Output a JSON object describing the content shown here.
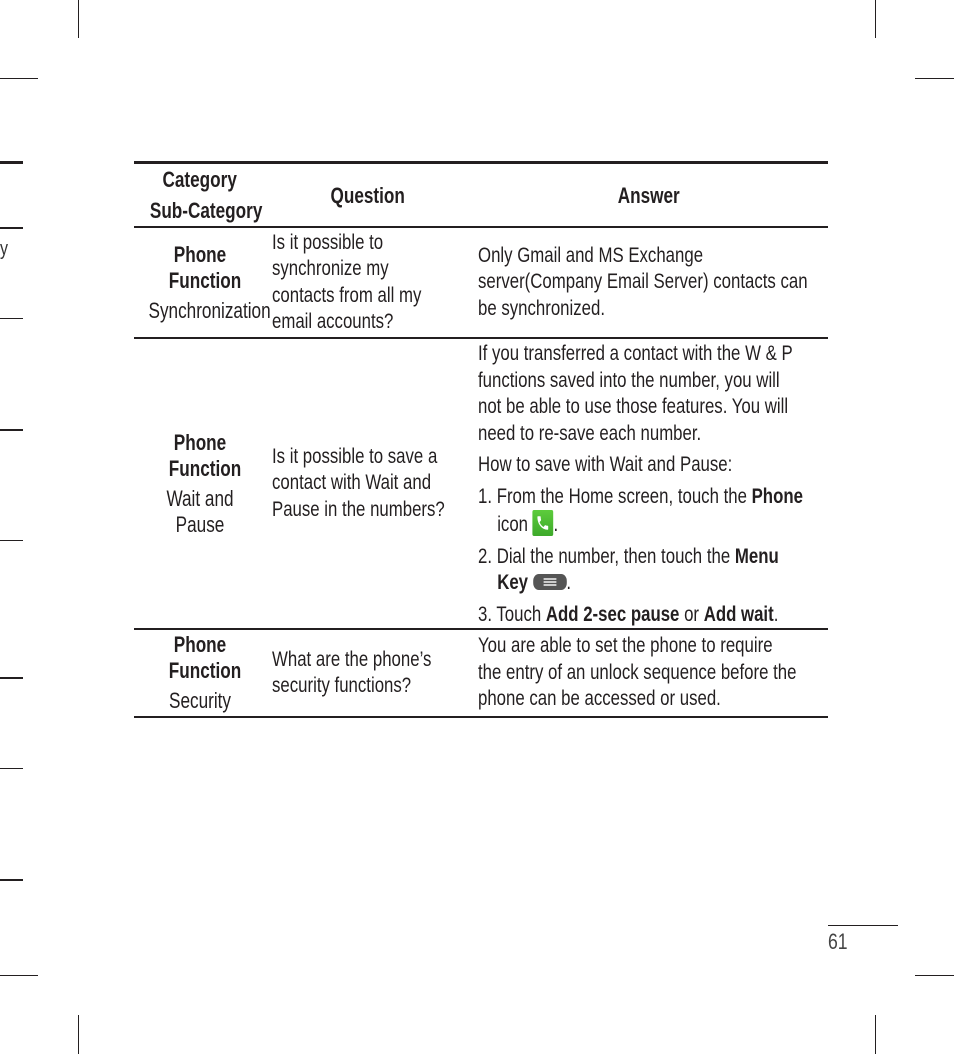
{
  "edge_fragment": "y",
  "table": {
    "headers": {
      "category": "Category",
      "subcategory": "Sub-Category",
      "question": "Question",
      "answer": "Answer"
    },
    "rows": [
      {
        "category": "Phone Function",
        "subcategory": "Synchronization",
        "question_lines": [
          "Is it possible to",
          "synchronize my",
          "contacts from all my",
          "email accounts?"
        ],
        "answer_lines": [
          "Only Gmail and MS Exchange",
          "server(Company Email Server) contacts can",
          "be synchronized."
        ]
      },
      {
        "category": "Phone Function",
        "subcategory_lines": [
          "Wait and",
          "Pause"
        ],
        "question_lines": [
          "Is it possible to save a",
          "contact with Wait and",
          "Pause in the numbers?"
        ],
        "answer_intro_lines": [
          "If you transferred a contact with the W & P",
          "functions saved into the number, you will",
          "not be able to use those features. You will",
          "need to re-save each number."
        ],
        "answer_howto": "How to save with Wait and Pause:",
        "steps": [
          {
            "num": "1.",
            "pre": "From the Home screen, touch the ",
            "bold": "Phone",
            "line2_pre": "icon ",
            "icon": "phone-icon",
            "post": "."
          },
          {
            "num": "2.",
            "pre": "Dial the number, then touch the ",
            "bold": "Menu",
            "line2_bold": "Key",
            "icon": "menu-key-icon",
            "post": "."
          },
          {
            "num": "3.",
            "pre": "Touch ",
            "bold1": "Add 2-sec pause",
            "mid": " or ",
            "bold2": "Add wait",
            "post": "."
          }
        ]
      },
      {
        "category": "Phone Function",
        "subcategory": "Security",
        "question_lines": [
          "What are the phone’s",
          "security functions?"
        ],
        "answer_lines": [
          "You are able to set the phone to require",
          "the entry of an unlock sequence before the",
          "phone can be accessed or used."
        ]
      }
    ]
  },
  "page_number": "61",
  "colors": {
    "phone_icon": "#4cbb35",
    "text": "#231f20"
  }
}
